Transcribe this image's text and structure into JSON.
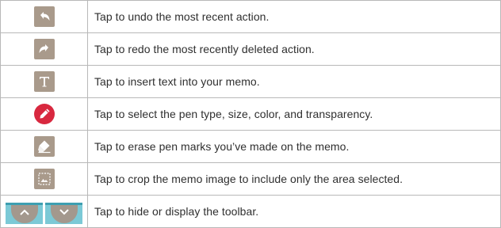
{
  "rows": [
    {
      "icon": "undo-icon",
      "text": "Tap to undo the most recent action."
    },
    {
      "icon": "redo-icon",
      "text": "Tap to redo the most recently deleted action."
    },
    {
      "icon": "text-icon",
      "text": "Tap to insert text into your memo."
    },
    {
      "icon": "pen-icon",
      "text": "Tap to select the pen type, size, color, and transparency."
    },
    {
      "icon": "eraser-icon",
      "text": "Tap to erase pen marks you’ve made on the memo."
    },
    {
      "icon": "crop-icon",
      "text": "Tap to crop the memo image to include only the area selected."
    },
    {
      "icon": "toolbar-toggle-icons",
      "text": "Tap to hide or display the toolbar."
    }
  ],
  "colors": {
    "icon_tile": "#a99a8b",
    "pen_accent": "#d8283f",
    "toolbar_toggle": "#7bc9d6",
    "border": "#b8b8b8",
    "text": "#2f2f2f"
  }
}
